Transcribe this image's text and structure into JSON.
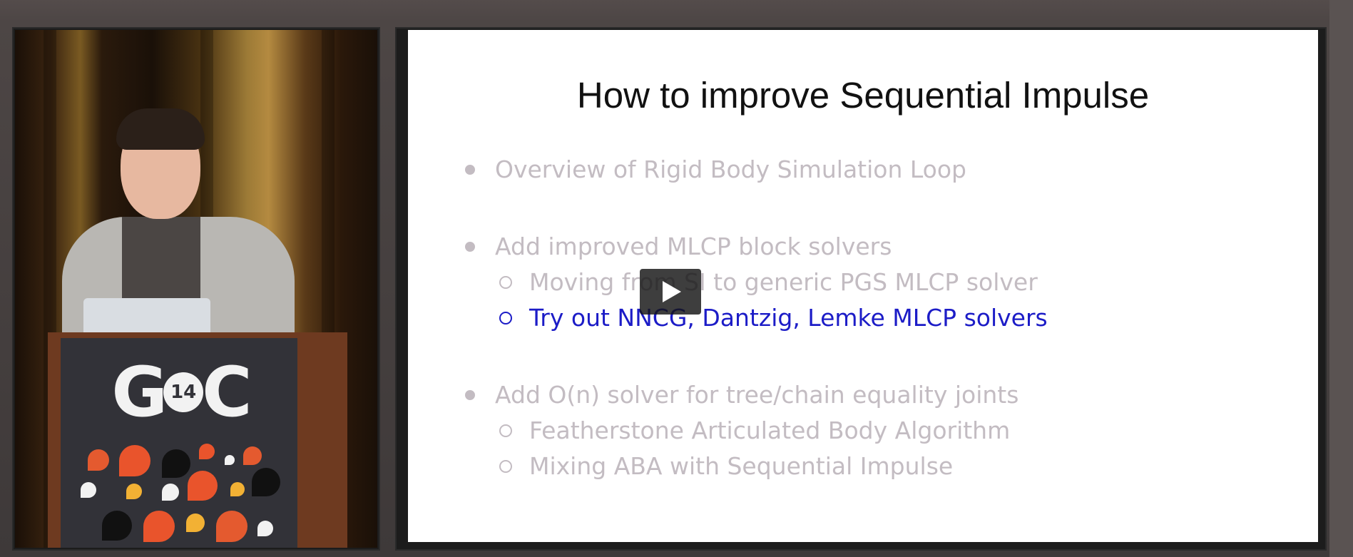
{
  "slide": {
    "title": "How to improve Sequential Impulse",
    "bullets": [
      {
        "level": 1,
        "state": "dim",
        "text": "Overview of Rigid Body Simulation Loop"
      },
      {
        "level": 1,
        "state": "dim",
        "text": "Add improved MLCP block solvers"
      },
      {
        "level": 2,
        "state": "dim",
        "text": "Moving from SI to generic PGS MLCP solver"
      },
      {
        "level": 2,
        "state": "active",
        "text": "Try out NNCG, Dantzig, Lemke MLCP solvers"
      },
      {
        "level": 1,
        "state": "dim",
        "text": "Add O(n) solver for tree/chain equality joints"
      },
      {
        "level": 2,
        "state": "dim",
        "text": "Featherstone Articulated Body Algorithm"
      },
      {
        "level": 2,
        "state": "dim",
        "text": "Mixing ABA with Sequential Impulse"
      }
    ]
  },
  "podium": {
    "logo_letters_left": "G",
    "logo_badge": "14",
    "logo_letters_right": "C"
  },
  "player": {
    "play_icon": "play-icon"
  },
  "colors": {
    "active_bullet": "#1c1cc7",
    "dim_bullet": "#c3bcc2",
    "slide_bg": "#ffffff"
  }
}
